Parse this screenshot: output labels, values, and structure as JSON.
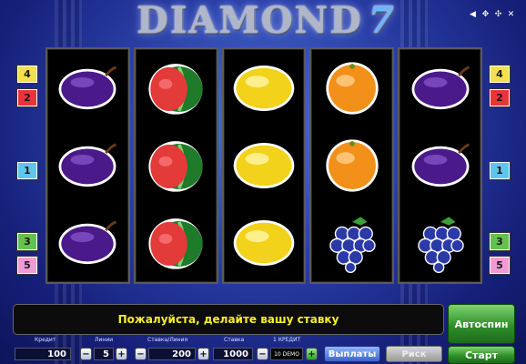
{
  "title": {
    "main": "DIAMOND",
    "seven": "7"
  },
  "top_icons": [
    "sound-icon",
    "fullscreen-icon",
    "settings-icon",
    "close-icon"
  ],
  "reels": [
    [
      "plum",
      "plum",
      "plum"
    ],
    [
      "watermelon",
      "watermelon",
      "watermelon"
    ],
    [
      "lemon",
      "lemon",
      "lemon"
    ],
    [
      "orange",
      "orange",
      "grapes"
    ],
    [
      "plum",
      "plum",
      "grapes"
    ]
  ],
  "lines_left": [
    {
      "label": "4",
      "color": "#f3e04a"
    },
    {
      "label": "2",
      "color": "#e8353a"
    },
    {
      "label": "1",
      "color": "#5ec4f0"
    },
    {
      "label": "3",
      "color": "#62c24e"
    },
    {
      "label": "5",
      "color": "#f29ad6"
    }
  ],
  "lines_right": [
    {
      "label": "4",
      "color": "#f3e04a"
    },
    {
      "label": "2",
      "color": "#e8353a"
    },
    {
      "label": "1",
      "color": "#5ec4f0"
    },
    {
      "label": "3",
      "color": "#62c24e"
    },
    {
      "label": "5",
      "color": "#f29ad6"
    }
  ],
  "message": "Пожалуйста, делайте вашу ставку",
  "autospin_label": "Автоспин",
  "controls": {
    "credit_label": "Кредит",
    "credit_value": "100",
    "lines_label": "Линии",
    "lines_value": "5",
    "bet_per_line_label": "Ставка/Линия",
    "bet_per_line_value": "200",
    "bet_label": "Ставка",
    "bet_value": "1000",
    "credit_unit_label": "1 КРЕДИТ",
    "demo_label": "10 DEMO",
    "minus": "−",
    "plus": "+",
    "payouts_label": "Выплаты",
    "risk_label": "Риск",
    "start_label": "Старт"
  }
}
